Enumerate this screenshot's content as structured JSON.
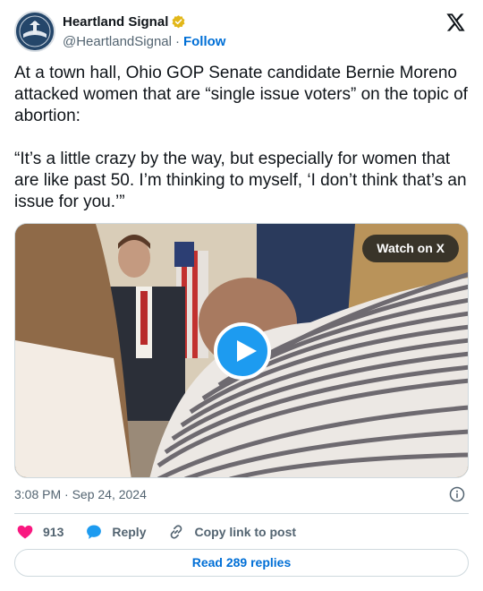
{
  "author": {
    "display_name": "Heartland Signal",
    "handle": "@HeartlandSignal",
    "separator": "·",
    "follow_label": "Follow"
  },
  "tweet": {
    "text": "At a town hall, Ohio GOP Senate candidate Bernie Moreno attacked women that are “single issue voters” on the topic of abortion:\n\n“It’s a little crazy by the way, but especially for women that are like past 50. I’m thinking to myself, ‘I don’t think that’s an issue for you.’”"
  },
  "media": {
    "watch_label": "Watch on X"
  },
  "meta": {
    "timestamp": "3:08 PM · Sep 24, 2024"
  },
  "actions": {
    "like_count": "913",
    "reply_label": "Reply",
    "copy_label": "Copy link to post"
  },
  "footer": {
    "read_replies_label": "Read 289 replies"
  },
  "colors": {
    "link_blue": "#006fd6",
    "play_blue": "#1d9bf0",
    "like_pink": "#f91880",
    "verified_gold": "#e2b719"
  }
}
